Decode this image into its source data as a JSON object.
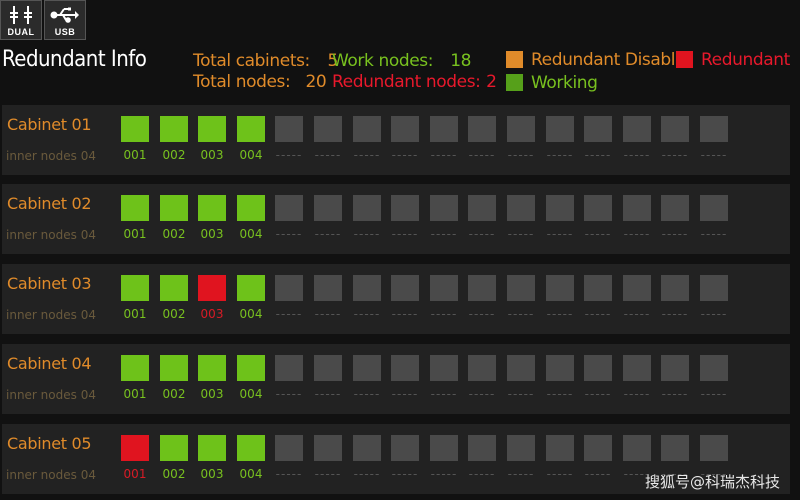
{
  "top_icons": [
    {
      "icon": "dual-power-icon",
      "label": "DUAL"
    },
    {
      "icon": "usb-icon",
      "label": "USB"
    }
  ],
  "title": "Redundant Info",
  "stats": {
    "total_cabinets_label": "Total cabinets:",
    "total_cabinets": "5",
    "total_nodes_label": "Total nodes:",
    "total_nodes": "20",
    "work_nodes_label": "Work nodes:",
    "work_nodes": "18",
    "redundant_nodes_label": "Redundant nodes:",
    "redundant_nodes": "2"
  },
  "legend": {
    "redundant_disable": "Redundant Disable",
    "redundant": "Redundant",
    "working": "Working"
  },
  "colors": {
    "working": "#6ec21a",
    "redundant": "#e0141f",
    "redundant_disable": "#e08b2a",
    "empty": "#4a4a4a"
  },
  "empty_label": "-----",
  "cabinets": [
    {
      "name": "Cabinet 01",
      "sub": "inner nodes 04",
      "nodes": [
        {
          "label": "001",
          "state": "working"
        },
        {
          "label": "002",
          "state": "working"
        },
        {
          "label": "003",
          "state": "working"
        },
        {
          "label": "004",
          "state": "working"
        }
      ]
    },
    {
      "name": "Cabinet 02",
      "sub": "inner nodes 04",
      "nodes": [
        {
          "label": "001",
          "state": "working"
        },
        {
          "label": "002",
          "state": "working"
        },
        {
          "label": "003",
          "state": "working"
        },
        {
          "label": "004",
          "state": "working"
        }
      ]
    },
    {
      "name": "Cabinet 03",
      "sub": "inner nodes 04",
      "nodes": [
        {
          "label": "001",
          "state": "working"
        },
        {
          "label": "002",
          "state": "working"
        },
        {
          "label": "003",
          "state": "redundant"
        },
        {
          "label": "004",
          "state": "working"
        }
      ]
    },
    {
      "name": "Cabinet 04",
      "sub": "inner nodes 04",
      "nodes": [
        {
          "label": "001",
          "state": "working"
        },
        {
          "label": "002",
          "state": "working"
        },
        {
          "label": "003",
          "state": "working"
        },
        {
          "label": "004",
          "state": "working"
        }
      ]
    },
    {
      "name": "Cabinet 05",
      "sub": "inner nodes 04",
      "nodes": [
        {
          "label": "001",
          "state": "redundant"
        },
        {
          "label": "002",
          "state": "working"
        },
        {
          "label": "003",
          "state": "working"
        },
        {
          "label": "004",
          "state": "working"
        }
      ]
    }
  ],
  "slots_per_cabinet": 16,
  "watermark": "搜狐号@科瑞杰科技"
}
